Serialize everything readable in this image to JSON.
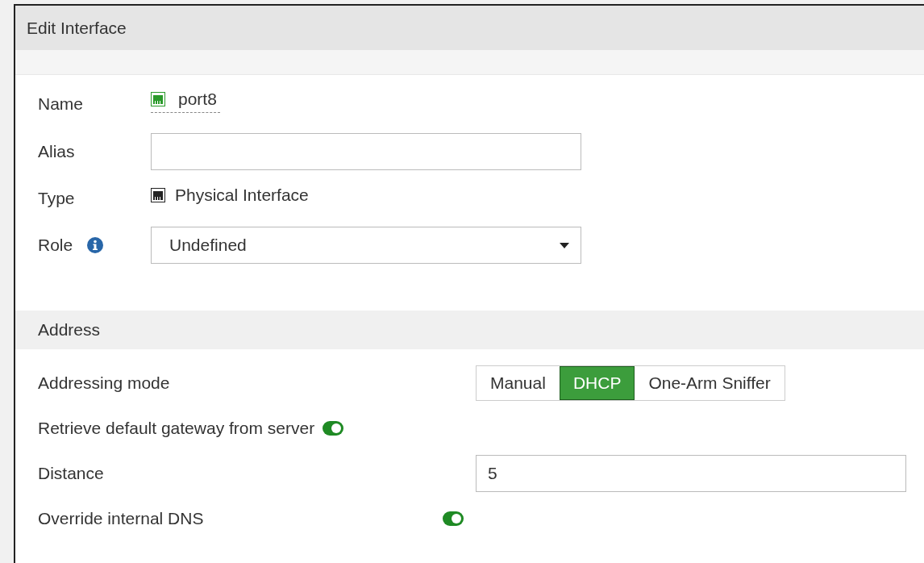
{
  "window": {
    "title": "Edit Interface"
  },
  "general": {
    "name_label": "Name",
    "name": "port8",
    "alias_label": "Alias",
    "type_label": "Type",
    "type": "Physical Interface",
    "role_label": "Role",
    "role": "Undefined"
  },
  "address": {
    "title": "Address",
    "mode_label": "Addressing mode",
    "modes": [
      {
        "label": "Manual",
        "selected": false
      },
      {
        "label": "DHCP",
        "selected": true
      },
      {
        "label": "One-Arm Sniffer",
        "selected": false
      }
    ],
    "retrieve_gateway": {
      "label": "Retrieve default gateway from server",
      "on": true
    },
    "distance": {
      "label": "Distance",
      "value": "5"
    },
    "override_dns": {
      "label": "Override internal DNS",
      "on": true
    }
  }
}
